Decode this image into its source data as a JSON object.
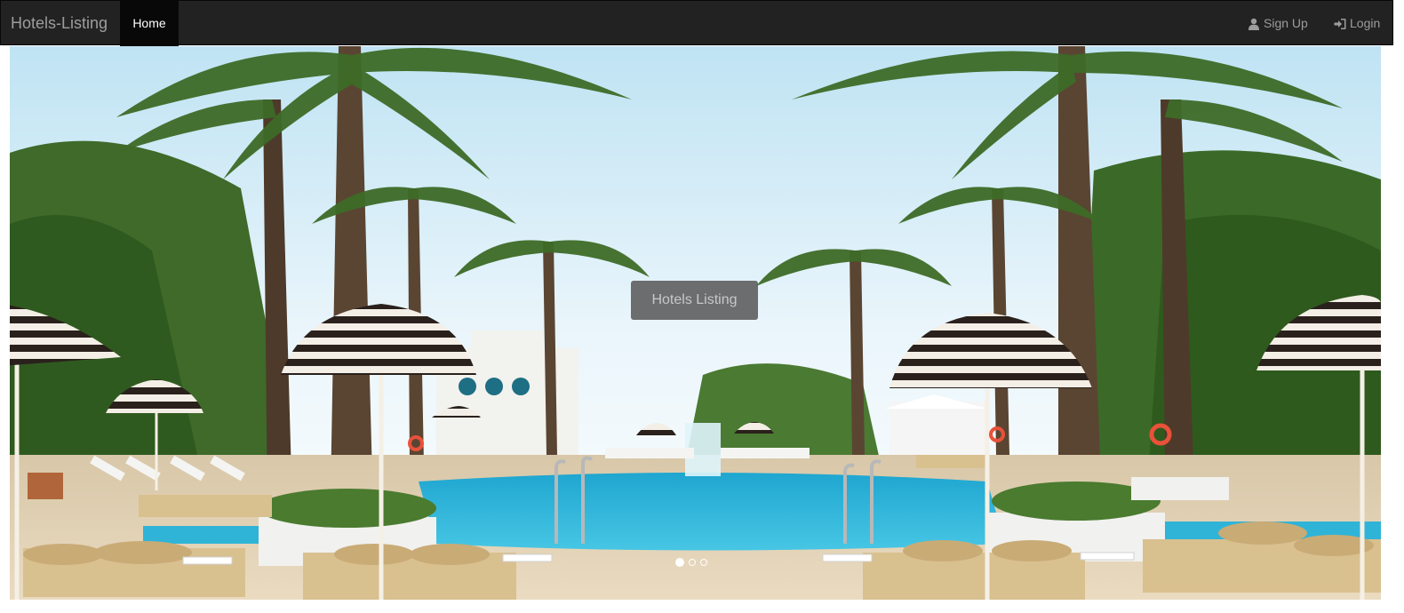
{
  "navbar": {
    "brand": "Hotels-Listing",
    "home_label": "Home",
    "signup_label": "Sign Up",
    "login_label": "Login",
    "signup_icon": "user-icon",
    "login_icon": "login-icon"
  },
  "carousel": {
    "caption": "Hotels Listing",
    "indicators": [
      "slide-1",
      "slide-2",
      "slide-3"
    ],
    "active_index": 0,
    "image_description_icon": "pool-scene-image"
  },
  "colors": {
    "navbar_bg": "#222222",
    "nav_active_bg": "#080808",
    "nav_text": "#9d9d9d",
    "pool_water": "#2fb8da",
    "sky": "#dff0f8"
  }
}
